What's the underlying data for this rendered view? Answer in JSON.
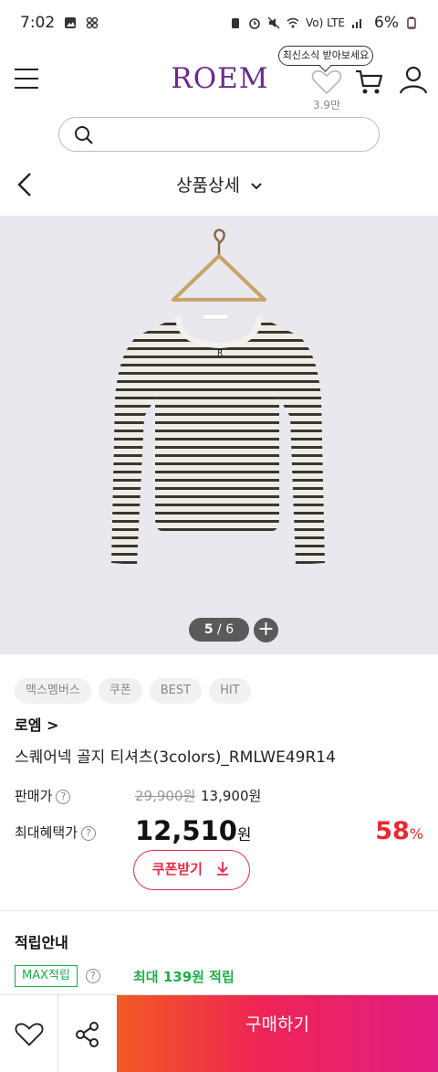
{
  "status_bar": {
    "time": "7:02",
    "network": "Vo) LTE",
    "battery": "6%"
  },
  "header": {
    "logo": "ROEM",
    "tooltip": "최신소식 받아보세요",
    "like_count": "3.9만"
  },
  "search": {
    "placeholder": ""
  },
  "page": {
    "title": "상품상세"
  },
  "gallery": {
    "current": "5",
    "total": "6",
    "separator": "/"
  },
  "tags": [
    "맥스멤버스",
    "쿠폰",
    "BEST",
    "HIT"
  ],
  "product": {
    "brand": "로엠 >",
    "name": "스퀘어넥 골지 티셔츠(3colors)_RMLWE49R14",
    "price_label": "판매가",
    "original_price": "29,900원",
    "sale_price": "13,900원",
    "benefit_label": "최대혜택가",
    "benefit_price": "12,510",
    "benefit_unit": "원",
    "discount": "58",
    "discount_unit": "%",
    "coupon_label": "쿠폰받기"
  },
  "reward": {
    "title": "적립안내",
    "badge": "MAX적립",
    "text": "최대 139원 적립"
  },
  "bottom": {
    "buy_label": "구매하기"
  },
  "colors": {
    "brand": "#6b2a8c",
    "accent_red": "#e32a45",
    "reward_green": "#1eae4b"
  }
}
